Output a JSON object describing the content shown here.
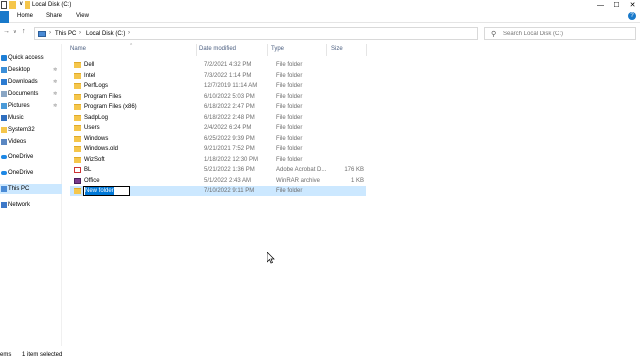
{
  "window": {
    "title": "Local Disk (C:)",
    "qa_dropdown": "∨",
    "controls": {
      "minimize": "—",
      "maximize": "☐",
      "close": "✕"
    }
  },
  "ribbon": {
    "tabs": [
      "Home",
      "Share",
      "View"
    ],
    "help": "?"
  },
  "address": {
    "breadcrumbs": [
      "This PC",
      "Local Disk (C:)"
    ],
    "separator": "›",
    "search_placeholder": "Search Local Disk (C:)"
  },
  "sidebar": {
    "items": [
      {
        "label": "Quick access",
        "icon": "star-icon",
        "color": "#1e7fd6",
        "pinned": false
      },
      {
        "label": "Desktop",
        "icon": "desktop-icon",
        "color": "#3b8fd9",
        "pinned": true
      },
      {
        "label": "Downloads",
        "icon": "download-icon",
        "color": "#2c7bd1",
        "pinned": true
      },
      {
        "label": "Documents",
        "icon": "documents-icon",
        "color": "#8aa6c4",
        "pinned": true
      },
      {
        "label": "Pictures",
        "icon": "pictures-icon",
        "color": "#4a9ad8",
        "pinned": true
      },
      {
        "label": "Music",
        "icon": "music-icon",
        "color": "#2f6fbf",
        "pinned": false
      },
      {
        "label": "System32",
        "icon": "folder-icon",
        "color": "#f5c64b",
        "pinned": false
      },
      {
        "label": "Videos",
        "icon": "videos-icon",
        "color": "#5a87c2",
        "pinned": false
      },
      {
        "label": "OneDrive",
        "icon": "cloud-icon",
        "color": "#1e88e5",
        "pinned": false
      },
      {
        "label": "OneDrive",
        "icon": "cloud-icon",
        "color": "#1e88e5",
        "pinned": false
      },
      {
        "label": "This PC",
        "icon": "computer-icon",
        "color": "#4a8bd6",
        "pinned": false,
        "selected": true
      },
      {
        "label": "Network",
        "icon": "network-icon",
        "color": "#3c78c8",
        "pinned": false
      }
    ]
  },
  "columns": {
    "name": "Name",
    "date": "Date modified",
    "type": "Type",
    "size": "Size"
  },
  "files": [
    {
      "name": "Dell",
      "date": "7/2/2021 4:32 PM",
      "type": "File folder",
      "size": "",
      "icon": "folder"
    },
    {
      "name": "Intel",
      "date": "7/3/2022 1:14 PM",
      "type": "File folder",
      "size": "",
      "icon": "folder"
    },
    {
      "name": "PerfLogs",
      "date": "12/7/2019 11:14 AM",
      "type": "File folder",
      "size": "",
      "icon": "folder"
    },
    {
      "name": "Program Files",
      "date": "6/10/2022 5:03 PM",
      "type": "File folder",
      "size": "",
      "icon": "folder"
    },
    {
      "name": "Program Files (x86)",
      "date": "6/18/2022 2:47 PM",
      "type": "File folder",
      "size": "",
      "icon": "folder"
    },
    {
      "name": "SadpLog",
      "date": "6/18/2022 2:48 PM",
      "type": "File folder",
      "size": "",
      "icon": "folder"
    },
    {
      "name": "Users",
      "date": "2/4/2022 6:24 PM",
      "type": "File folder",
      "size": "",
      "icon": "folder"
    },
    {
      "name": "Windows",
      "date": "6/25/2022 9:39 PM",
      "type": "File folder",
      "size": "",
      "icon": "folder"
    },
    {
      "name": "Windows.old",
      "date": "9/21/2021 7:52 PM",
      "type": "File folder",
      "size": "",
      "icon": "folder"
    },
    {
      "name": "WizSoft",
      "date": "1/18/2022 12:30 PM",
      "type": "File folder",
      "size": "",
      "icon": "folder"
    },
    {
      "name": "BL",
      "date": "5/21/2022 1:36 PM",
      "type": "Adobe Acrobat D...",
      "size": "176 KB",
      "icon": "pdf"
    },
    {
      "name": "Office",
      "date": "5/1/2022 2:43 AM",
      "type": "WinRAR archive",
      "size": "1 KB",
      "icon": "rar"
    },
    {
      "name": "New folder",
      "date": "7/10/2022 9:11 PM",
      "type": "File folder",
      "size": "",
      "icon": "folder",
      "selected": true,
      "renaming": true
    }
  ],
  "status": {
    "items_count": "ems",
    "selected_text": "1 item selected"
  }
}
